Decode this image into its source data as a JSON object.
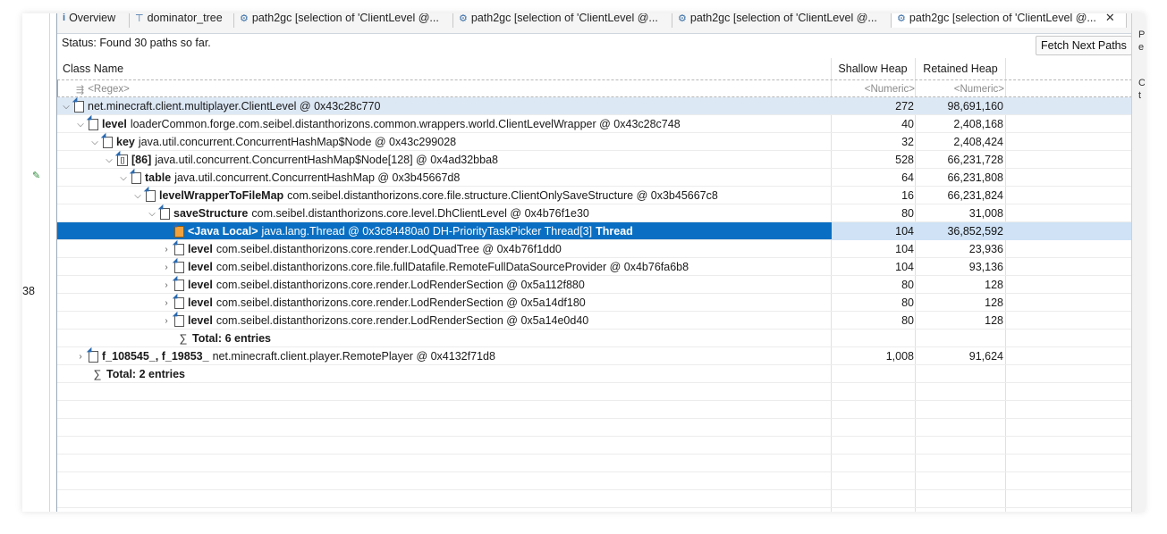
{
  "tabs": [
    {
      "label": "Overview",
      "icon": "info-icon"
    },
    {
      "label": "dominator_tree",
      "icon": "tree-icon"
    },
    {
      "label": "path2gc [selection of 'ClientLevel @...",
      "icon": "path-icon"
    },
    {
      "label": "path2gc [selection of 'ClientLevel @...",
      "icon": "path-icon"
    },
    {
      "label": "path2gc [selection of 'ClientLevel @...",
      "icon": "path-icon"
    },
    {
      "label": "path2gc [selection of 'ClientLevel @...",
      "icon": "path-icon"
    }
  ],
  "tab_close": "✕",
  "status": {
    "text": "Status:  Found 30 paths so far."
  },
  "fetch_button": "Fetch Next Paths",
  "columns": {
    "class_name": "Class Name",
    "shallow_heap": "Shallow Heap",
    "retained_heap": "Retained Heap"
  },
  "filter": {
    "regex": "<Regex>",
    "shallow": "<Numeric>",
    "retained": "<Numeric>"
  },
  "left_strip": {
    "number": "38"
  },
  "right_strip": [
    "P",
    "e",
    "C",
    "t"
  ],
  "rows": [
    {
      "label": "",
      "text": "net.minecraft.client.multiplayer.ClientLevel @ 0x43c28c770",
      "shallow": "272",
      "retained": "98,691,160"
    },
    {
      "label": "level",
      "text": "loaderCommon.forge.com.seibel.distanthorizons.common.wrappers.world.ClientLevelWrapper @ 0x43c28c748",
      "shallow": "40",
      "retained": "2,408,168"
    },
    {
      "label": "key",
      "text": "java.util.concurrent.ConcurrentHashMap$Node @ 0x43c299028",
      "shallow": "32",
      "retained": "2,408,424"
    },
    {
      "label": "[86]",
      "text": "java.util.concurrent.ConcurrentHashMap$Node[128] @ 0x4ad32bba8",
      "shallow": "528",
      "retained": "66,231,728"
    },
    {
      "label": "table",
      "text": "java.util.concurrent.ConcurrentHashMap @ 0x3b45667d8",
      "shallow": "64",
      "retained": "66,231,808"
    },
    {
      "label": "levelWrapperToFileMap",
      "text": "com.seibel.distanthorizons.core.file.structure.ClientOnlySaveStructure @ 0x3b45667c8",
      "shallow": "16",
      "retained": "66,231,824"
    },
    {
      "label": "saveStructure",
      "text": "com.seibel.distanthorizons.core.level.DhClientLevel @ 0x4b76f1e30",
      "shallow": "80",
      "retained": "31,008"
    },
    {
      "label": "<Java Local>",
      "text": "java.lang.Thread @ 0x3c84480a0  DH-PriorityTaskPicker Thread[3]",
      "suffix": "Thread",
      "shallow": "104",
      "retained": "36,852,592"
    },
    {
      "label": "level",
      "text": "com.seibel.distanthorizons.core.render.LodQuadTree @ 0x4b76f1dd0",
      "shallow": "104",
      "retained": "23,936"
    },
    {
      "label": "level",
      "text": "com.seibel.distanthorizons.core.file.fullDatafile.RemoteFullDataSourceProvider @ 0x4b76fa6b8",
      "shallow": "104",
      "retained": "93,136"
    },
    {
      "label": "level",
      "text": "com.seibel.distanthorizons.core.render.LodRenderSection @ 0x5a112f880",
      "shallow": "80",
      "retained": "128"
    },
    {
      "label": "level",
      "text": "com.seibel.distanthorizons.core.render.LodRenderSection @ 0x5a14df180",
      "shallow": "80",
      "retained": "128"
    },
    {
      "label": "level",
      "text": "com.seibel.distanthorizons.core.render.LodRenderSection @ 0x5a14e0d40",
      "shallow": "80",
      "retained": "128"
    },
    {
      "label": "Total: 6 entries",
      "text": "",
      "shallow": "",
      "retained": ""
    },
    {
      "label": "f_108545_, f_19853_",
      "text": "net.minecraft.client.player.RemotePlayer @ 0x4132f71d8",
      "shallow": "1,008",
      "retained": "91,624"
    },
    {
      "label": "Total: 2 entries",
      "text": "",
      "shallow": "",
      "retained": ""
    }
  ],
  "colors": {
    "selection": "#0a6fc2",
    "root_row": "#dde8f5"
  }
}
